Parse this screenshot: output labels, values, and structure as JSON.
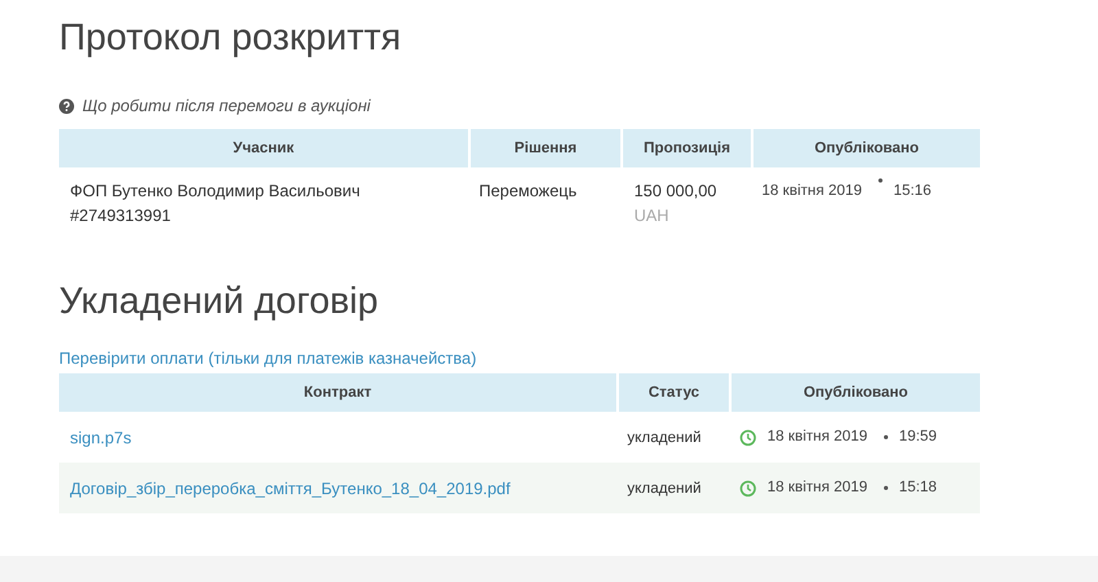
{
  "auction_protocol": {
    "title": "Протокол розкриття",
    "help_link": "Що робити після перемоги в аукціоні",
    "columns": [
      "Учасник",
      "Рішення",
      "Пропозиція",
      "Опубліковано"
    ],
    "rows": [
      {
        "participant": "ФОП Бутенко Володимир Васильович",
        "participant_id": "#2749313991",
        "decision": "Переможець",
        "amount": "150 000,00",
        "currency": "UAH",
        "date": "18 квітня 2019",
        "time": "15:16"
      }
    ]
  },
  "contract": {
    "title": "Укладений договір",
    "payments_link": "Перевірити оплати (тільки для платежів казначейства)",
    "columns": [
      "Контракт",
      "Статус",
      "Опубліковано"
    ],
    "rows": [
      {
        "file": "sign.p7s",
        "status": "укладений",
        "date": "18 квітня 2019",
        "time": "19:59"
      },
      {
        "file": "Договір_збір_переробка_сміття_Бутенко_18_04_2019.pdf",
        "status": "укладений",
        "date": "18 квітня 2019",
        "time": "15:18"
      }
    ]
  }
}
